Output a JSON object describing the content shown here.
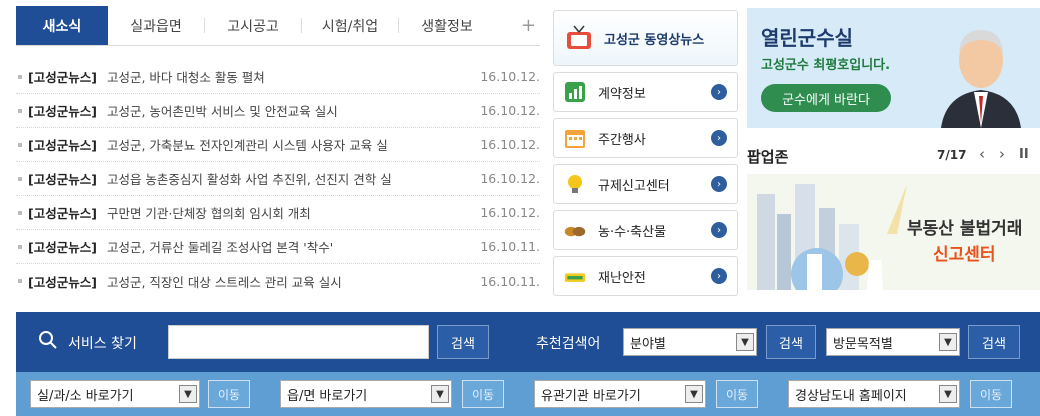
{
  "news": {
    "tabs": [
      {
        "label": "새소식"
      },
      {
        "label": "실과읍면"
      },
      {
        "label": "고시공고"
      },
      {
        "label": "시험/취업"
      },
      {
        "label": "생활정보"
      }
    ],
    "more_label": "+",
    "items": [
      {
        "category": "[고성군뉴스]",
        "title": "고성군, 바다 대청소 활동 펼쳐",
        "date": "16.10.12."
      },
      {
        "category": "[고성군뉴스]",
        "title": "고성군, 농어촌민박 서비스 및 안전교육 실시",
        "date": "16.10.12."
      },
      {
        "category": "[고성군뉴스]",
        "title": "고성군, 가축분뇨 전자인계관리 시스템 사용자 교육 실",
        "date": "16.10.12."
      },
      {
        "category": "[고성군뉴스]",
        "title": "고성읍 농촌중심지 활성화 사업 추진위, 선진지 견학 실",
        "date": "16.10.12."
      },
      {
        "category": "[고성군뉴스]",
        "title": "구만면 기관·단체장 협의회 임시회 개최",
        "date": "16.10.12."
      },
      {
        "category": "[고성군뉴스]",
        "title": "고성군, 거류산 둘레길 조성사업 본격 '착수'",
        "date": "16.10.11."
      },
      {
        "category": "[고성군뉴스]",
        "title": "고성군, 직장인 대상 스트레스 관리 교육 실시",
        "date": "16.10.11."
      }
    ]
  },
  "quick_menu": {
    "video_news": "고성군 동영상뉴스",
    "items": [
      {
        "label": "계약정보",
        "icon": "chart-icon"
      },
      {
        "label": "주간행사",
        "icon": "calendar-icon"
      },
      {
        "label": "규제신고센터",
        "icon": "lightbulb-icon"
      },
      {
        "label": "농·수·축산물",
        "icon": "produce-icon"
      },
      {
        "label": "재난안전",
        "icon": "safety-icon"
      }
    ]
  },
  "mayor": {
    "title": "열린군수실",
    "subtitle": "고성군수 최평호입니다.",
    "button": "군수에게 바란다"
  },
  "popup": {
    "title": "팝업존",
    "count": "7/17",
    "prev": "‹",
    "next": "›",
    "pause": "II",
    "banner_line1": "부동산 불법거래",
    "banner_line2": "신고센터"
  },
  "search": {
    "label": "서비스 찾기",
    "input_value": "",
    "search_btn": "검색",
    "recommend_label": "추천검색어",
    "select1": "분야별",
    "select1_btn": "검색",
    "select2": "방문목적별",
    "select2_btn": "검색"
  },
  "shortcuts": [
    {
      "select": "실/과/소 바로가기",
      "button": "이동"
    },
    {
      "select": "읍/면 바로가기",
      "button": "이동"
    },
    {
      "select": "유관기관 바로가기",
      "button": "이동"
    },
    {
      "select": "경상남도내 홈페이지",
      "button": "이동"
    }
  ],
  "colors": {
    "primary": "#1f4e96",
    "secondary": "#5e9ed2",
    "accent_green": "#2e8d4f",
    "accent_orange": "#e8531c"
  }
}
